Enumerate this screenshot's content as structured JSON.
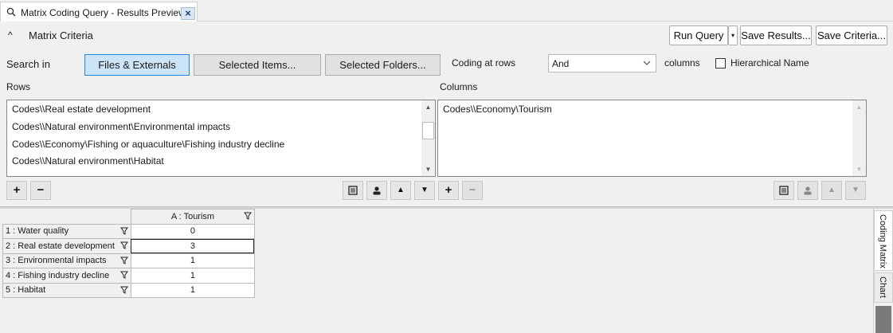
{
  "tab": {
    "title": "Matrix Coding Query - Results Preview",
    "close": "×"
  },
  "criteria": {
    "toggle": "^",
    "title": "Matrix Criteria",
    "run_query": "Run Query",
    "run_split": "▾",
    "save_results": "Save Results...",
    "save_criteria": "Save Criteria..."
  },
  "search": {
    "label": "Search in",
    "buttons": [
      "Files & Externals",
      "Selected Items...",
      "Selected Folders..."
    ],
    "coding_label": "Coding at rows",
    "combo_value": "And",
    "columns_label": "columns",
    "hierarchical_label": "Hierarchical Name"
  },
  "rows": {
    "label": "Rows",
    "items": [
      "Codes\\\\Real estate development",
      "Codes\\\\Natural environment\\Environmental impacts",
      "Codes\\\\Economy\\Fishing or aquaculture\\Fishing industry decline",
      "Codes\\\\Natural environment\\Habitat"
    ]
  },
  "columns": {
    "label": "Columns",
    "items": [
      "Codes\\\\Economy\\Tourism"
    ]
  },
  "matrix": {
    "column_header": "A : Tourism",
    "rows": [
      {
        "label": "1 : Water quality",
        "value": "0"
      },
      {
        "label": "2 : Real estate development",
        "value": "3"
      },
      {
        "label": "3 : Environmental impacts",
        "value": "1"
      },
      {
        "label": "4 : Fishing industry decline",
        "value": "1"
      },
      {
        "label": "5 : Habitat",
        "value": "1"
      }
    ]
  },
  "side_tabs": {
    "coding_matrix": "Coding Matrix",
    "chart": "Chart"
  },
  "colors": {
    "active_button": "#cce4f7",
    "active_border": "#2b86d9"
  }
}
